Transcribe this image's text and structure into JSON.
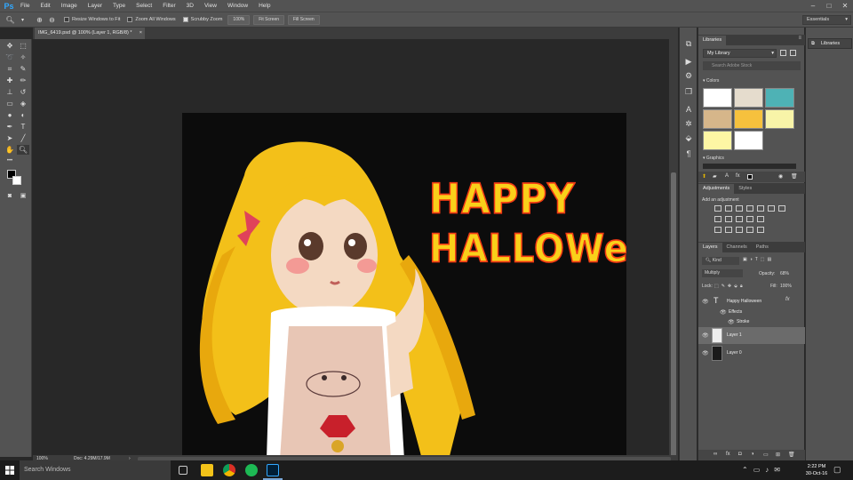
{
  "app": {
    "logo": "Ps"
  },
  "menu": [
    "File",
    "Edit",
    "Image",
    "Layer",
    "Type",
    "Select",
    "Filter",
    "3D",
    "View",
    "Window",
    "Help"
  ],
  "options": {
    "resize_windows": "Resize Windows to Fit",
    "zoom_all": "Zoom All Windows",
    "scrubby_zoom": "Scrubby Zoom",
    "btn_100": "100%",
    "fit_screen": "Fit Screen",
    "fill_screen": "Fill Screen",
    "workspace": "Essentials"
  },
  "document": {
    "tab_title": "IMG_6419.psd @ 100% (Layer 1, RGB/8) *",
    "zoom": "100%",
    "doc_info": "Doc: 4.29M/17.9M",
    "text_line1": "HAPPY",
    "text_line2": "HALLOWeeN"
  },
  "libraries": {
    "tab": "Libraries",
    "library_name": "My Library",
    "search_placeholder": "Search Adobe Stock",
    "colors_section": "Colors",
    "graphics_section": "Graphics",
    "swatches": [
      "#ffffff",
      "#e5dccd",
      "#4eb2b5",
      "#d6b68a",
      "#f6c13d",
      "#f8f4a8",
      "#fdf6a4",
      "#ffffff"
    ]
  },
  "adjustments": {
    "tab": "Adjustments",
    "tab2": "Styles",
    "hint": "Add an adjustment"
  },
  "layers": {
    "tabs": [
      "Layers",
      "Channels",
      "Paths"
    ],
    "kind": "Kind",
    "blend_mode": "Multiply",
    "opacity_label": "Opacity:",
    "opacity": "68%",
    "lock_label": "Lock:",
    "fill_label": "Fill:",
    "fill": "100%",
    "items": [
      {
        "name": "Happy Halloween",
        "type": "text"
      },
      {
        "name": "Effects",
        "type": "effect"
      },
      {
        "name": "Stroke",
        "type": "effect"
      },
      {
        "name": "Layer 1",
        "type": "pixel"
      },
      {
        "name": "Layer 0",
        "type": "pixel"
      }
    ]
  },
  "far_panel": {
    "libraries": "Libraries"
  },
  "taskbar": {
    "search_placeholder": "Search Windows",
    "time": "2:22 PM",
    "date": "30-Oct-16"
  }
}
